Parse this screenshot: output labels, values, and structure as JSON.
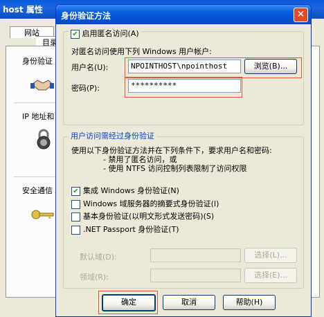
{
  "background_window": {
    "title": "host 属性",
    "tab_label": "网站",
    "tab_label_2": "目录",
    "group_labels": [
      "身份验证",
      "IP 地址和",
      "安全通信"
    ]
  },
  "dialog": {
    "title": "身份验证方法",
    "anon_checkbox_label": "启用匿名访问(A)",
    "anon_checked": true,
    "anon_desc": "对匿名访问使用下列 Windows 用户帐户:",
    "username_label": "用户名(U):",
    "username_value": "NPOINTHOST\\npointhost",
    "browse_label": "浏览(B)...",
    "password_label": "密码(P):",
    "password_value": "**********",
    "auth_group_title": "用户访问需经过身份验证",
    "auth_desc_1": "使用以下身份验证方法并在下列条件下，要求用户名和密码:",
    "auth_desc_2": "- 禁用了匿名访问，或",
    "auth_desc_3": "- 使用 NTFS 访问控制列表限制了访问权限",
    "options": [
      {
        "label": "集成 Windows 身份验证(N)",
        "checked": true
      },
      {
        "label": "Windows 域服务器的摘要式身份验证(I)",
        "checked": false
      },
      {
        "label": "基本身份验证(以明文形式发送密码)(S)",
        "checked": false
      },
      {
        "label": ".NET Passport 身份验证(T)",
        "checked": false
      }
    ],
    "default_domain_label": "默认域(D):",
    "realm_label": "领域(R):",
    "select_label_1": "选择(L)...",
    "select_label_2": "选择(E)...",
    "ok_label": "确定",
    "cancel_label": "取消",
    "help_label": "帮助(H)"
  },
  "colors": {
    "title_blue": "#0A5FE0",
    "highlight": "#E05A3A",
    "close_red": "#E04A2B"
  }
}
